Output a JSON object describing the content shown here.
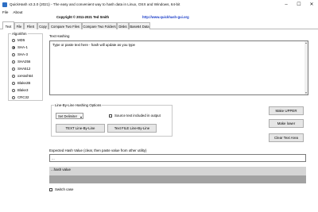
{
  "window": {
    "title": "QuickHash v3.3.0 (2021) - The easy and convenient way to hash data in Linux, OSX and Windows, 64-bit",
    "controls": {
      "minimize": "–",
      "maximize": "☐",
      "close": "✕"
    },
    "brand_color": "#2d6fc4"
  },
  "menu": {
    "file": "File",
    "about": "About"
  },
  "info": {
    "copyright": "Copyright © 2011-2021 Ted Smith",
    "website": "http://www.quickhash-gui.org"
  },
  "tabs": [
    {
      "label": "Text",
      "active": true
    },
    {
      "label": "File"
    },
    {
      "label": "FileS"
    },
    {
      "label": "Copy"
    },
    {
      "label": "Compare Two Files"
    },
    {
      "label": "Compare Two Folders"
    },
    {
      "label": "Disks"
    },
    {
      "label": "Base64 Data"
    }
  ],
  "algorithms": {
    "legend": "Algorithm",
    "items": [
      "MD5",
      "SHA-1",
      "SHA-3",
      "SHA256",
      "SHA512",
      "xxHash64",
      "Blake2B",
      "Blake3",
      "CRC32"
    ],
    "selected": "SHA-1"
  },
  "text_hashing": {
    "label": "Text Hashing",
    "value": "Type or paste text here - hash will update as you type"
  },
  "line_by_line": {
    "legend": "Line-By-Line Hashing Options",
    "delimiter": "Set Delimiter",
    "source_checkbox": "Source text included in output",
    "text_button": "TEXT Line-By-Line",
    "file_button": "Text FILE Line-By-Line"
  },
  "buttons": {
    "make_upper": "Make UPPER",
    "make_lower": "Make lower",
    "clear_text": "Clear Text Area"
  },
  "expected": {
    "label": "Expected Hash Value (clear, then paste value from other utility)",
    "value": "..."
  },
  "hash_value": {
    "label": "...hash value"
  },
  "switch_case": {
    "label": "Switch case"
  }
}
